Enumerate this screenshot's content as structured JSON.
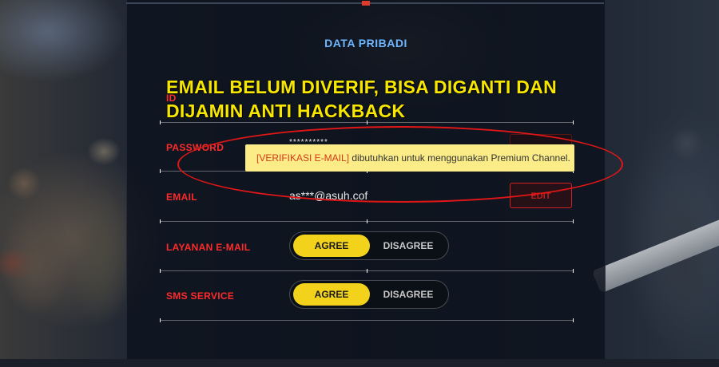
{
  "panel": {
    "title": "DATA PRIBADI"
  },
  "rows": {
    "id_label": "ID",
    "password_label": "PASSWORD",
    "password_value": "**********",
    "email_label": "EMAIL",
    "email_value": "as***@asuh.cof",
    "email_edit": "EDIT",
    "email_service_label": "LAYANAN E-MAIL",
    "sms_label": "SMS SERVICE"
  },
  "toggles": {
    "agree": "AGREE",
    "disagree": "DISAGREE"
  },
  "tooltip": {
    "tag": "[VERIFIKASI E-MAIL]",
    "text": " dibutuhkan untuk menggunakan Premium Channel."
  },
  "annotation": {
    "line1": "EMAIL BELUM DIVERIF, BISA DIGANTI DAN",
    "line2": "DIJAMIN ANTI HACKBACK"
  },
  "colors": {
    "title": "#6fb6ff",
    "label": "#ff2a2a",
    "toggle_active": "#f2d21a",
    "annotation": "#f6e600",
    "ellipse": "#e11616",
    "tooltip_bg": "#fbec87"
  }
}
